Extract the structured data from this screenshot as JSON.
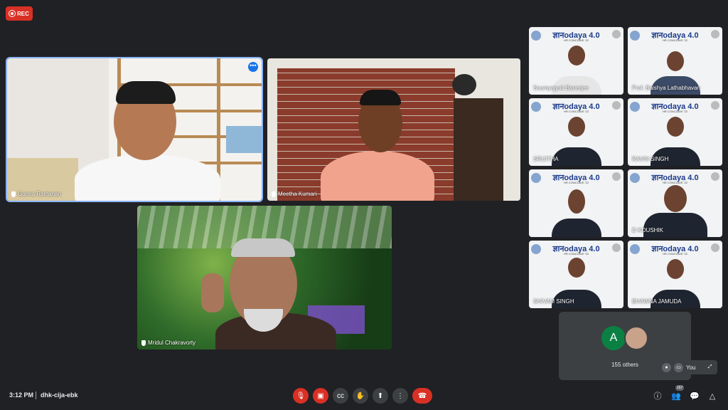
{
  "recording": {
    "label": "REC"
  },
  "main_tiles": [
    {
      "name": "Gunna Ramanan"
    },
    {
      "name": "Meetha Kumari"
    },
    {
      "name": "Mridul Chakravorty"
    }
  ],
  "side_tiles": [
    {
      "name": "Soumyajyoti Banerjee"
    },
    {
      "name": "Prof. Baishya Lathabhavan"
    },
    {
      "name": "SRIJITHA"
    },
    {
      "name": "RAVIN SINGH"
    },
    {
      "name": ""
    },
    {
      "name": "D KOUSHIK"
    },
    {
      "name": "SHIVAM SINGH"
    },
    {
      "name": "BHAWNA JAMUDA"
    }
  ],
  "branding": {
    "title": "ज्ञानodaya 4.0",
    "subtitle": "HR CONCLAVE '22"
  },
  "others_panel": {
    "avatar_letter": "A",
    "label": "155 others",
    "avatar_a_color": "#0b8043"
  },
  "self_view": {
    "label": "You"
  },
  "bottom_bar": {
    "time": "3:12 PM",
    "meeting_code": "dhk-cija-ebk",
    "participants_count": "167",
    "controls": [
      "mic-off",
      "camera-off",
      "captions",
      "raise-hand",
      "present",
      "more",
      "hang-up"
    ]
  }
}
